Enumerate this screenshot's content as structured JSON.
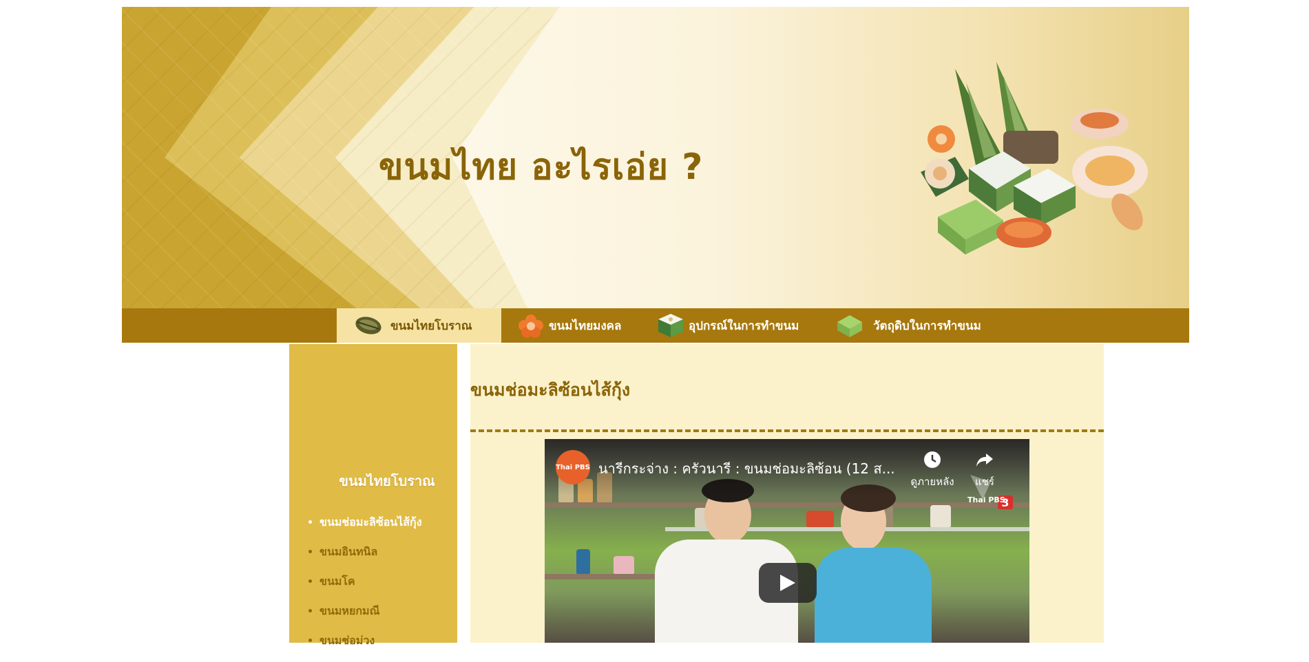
{
  "header": {
    "site_title": "ขนมไทย อะไรเอ่ย ?"
  },
  "nav": {
    "items": [
      {
        "label": "ขนมไทยโบราณ",
        "icon": "wrapped-dessert-icon",
        "active": true
      },
      {
        "label": "ขนมไทยมงคล",
        "icon": "flower-dessert-icon",
        "active": false
      },
      {
        "label": "อุปกรณ์ในการทำขนม",
        "icon": "pandan-cup-icon",
        "active": false
      },
      {
        "label": "วัตถุดิบในการทำขนม",
        "icon": "green-layer-cake-icon",
        "active": false
      }
    ]
  },
  "sidebar": {
    "title": "ขนมไทยโบราณ",
    "items": [
      {
        "label": "ขนมช่อมะลิซ้อนไส้กุ้ง",
        "active": true
      },
      {
        "label": "ขนมอินทนิล",
        "active": false
      },
      {
        "label": "ขนมโค",
        "active": false
      },
      {
        "label": "ขนมหยกมณี",
        "active": false
      },
      {
        "label": "ขนมช่อม่วง",
        "active": false
      }
    ]
  },
  "article": {
    "title": "ขนมช่อมะลิซ้อนไส้กุ้ง"
  },
  "video": {
    "title": "นารีกระจ่าง : ครัวนารี : ขนมช่อมะลิซ้อน (12 ส...",
    "channel": "Thai PBS",
    "watch_later_label": "ดูภายหลัง",
    "share_label": "แชร์",
    "broadcaster_logo": "Thai PBS 3"
  },
  "colors": {
    "brand_gold": "#a7780d",
    "title_brown": "#8a6408",
    "sidebar_bg": "#e0bb46",
    "content_bg": "#fbf2cc",
    "active_tab_bg": "#f6e3a3"
  }
}
